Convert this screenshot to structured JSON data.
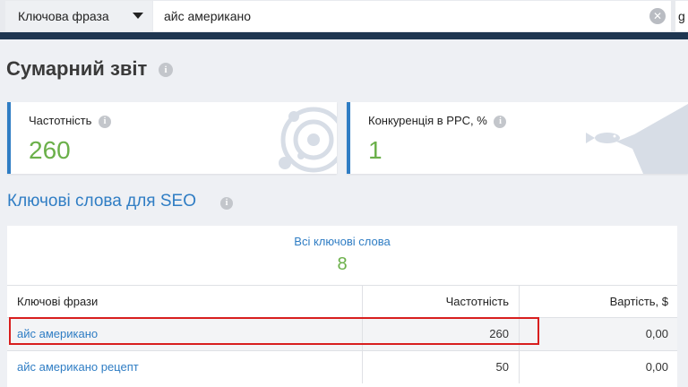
{
  "search": {
    "type_label": "Ключова фраза",
    "query": "айс американо",
    "db_label": "g"
  },
  "page": {
    "title": "Сумарний звіт"
  },
  "cards": [
    {
      "label": "Частотність",
      "value": "260"
    },
    {
      "label": "Конкуренція в PPC, %",
      "value": "1"
    }
  ],
  "seo": {
    "title": "Ключові слова для SEO",
    "all_label": "Всі ключові слова",
    "all_value": "8",
    "columns": [
      "Ключові фрази",
      "Частотність",
      "Вартість, $"
    ],
    "rows": [
      {
        "keyword": "айс американо",
        "freq": "260",
        "cost": "0,00"
      },
      {
        "keyword": "айс американо рецепт",
        "freq": "50",
        "cost": "0,00"
      }
    ]
  },
  "icons": {
    "info": "info-icon",
    "clear": "clear-icon",
    "dropdown": "chevron-down-icon",
    "card1_decor": "orbit-icon",
    "card2_decor": "fish-icon"
  },
  "colors": {
    "accent": "#2f7dc4",
    "value_green": "#6bb04a",
    "navy": "#1f3651",
    "highlight": "#d81e1e"
  }
}
